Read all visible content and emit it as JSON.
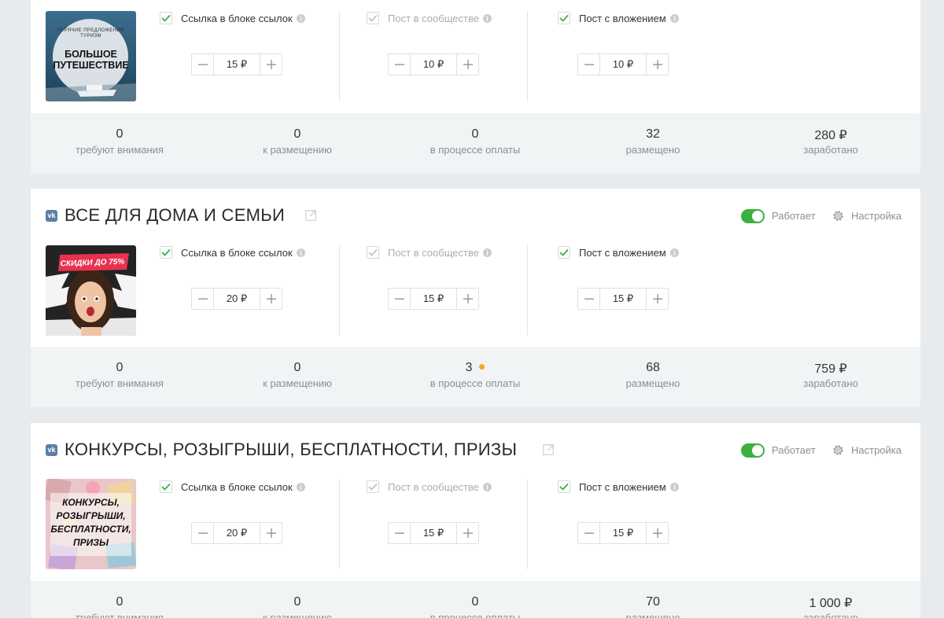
{
  "options": {
    "link_block": "Ссылка в блоке ссылок",
    "community_post": "Пост в сообществе",
    "attachment_post": "Пост с вложением"
  },
  "header": {
    "status": "Работает",
    "settings": "Настройка",
    "vk_badge": "vk"
  },
  "stat_labels": {
    "attention": "требуют внимания",
    "to_place": "к размещению",
    "paying": "в процессе оплаты",
    "placed": "размещено",
    "earned": "заработано"
  },
  "colors": {
    "accent_green": "#3cb043",
    "pending_dot": "#f5a623",
    "vk_blue": "#5b7fa6"
  },
  "cards": [
    {
      "title": "",
      "thumb_text_top": "ГОРЯЧИЕ ПРЕДЛОЖЕНИЯ ТУРИЗМ",
      "thumb_text_main": "БОЛЬШОЕ ПУТЕШЕСТВИЕ",
      "prices": [
        "15 ₽",
        "10 ₽",
        "10 ₽"
      ],
      "stats": [
        "0",
        "0",
        "0",
        "32",
        "280 ₽"
      ],
      "pending": false
    },
    {
      "title": "ВСЕ ДЛЯ ДОМА И СЕМЬИ",
      "thumb_text_main": "СКИДКИ ДО 75%",
      "prices": [
        "20 ₽",
        "15 ₽",
        "15 ₽"
      ],
      "stats": [
        "0",
        "0",
        "3",
        "68",
        "759 ₽"
      ],
      "pending": true
    },
    {
      "title": "КОНКУРСЫ, РОЗЫГРЫШИ, БЕСПЛАТНОСТИ, ПРИЗЫ",
      "thumb_text_main": "КОНКУРСЫ, РОЗЫГРЫШИ, БЕСПЛАТНОСТИ, ПРИЗЫ",
      "prices": [
        "20 ₽",
        "15 ₽",
        "15 ₽"
      ],
      "stats": [
        "0",
        "0",
        "0",
        "70",
        "1 000 ₽"
      ],
      "pending": false
    }
  ]
}
